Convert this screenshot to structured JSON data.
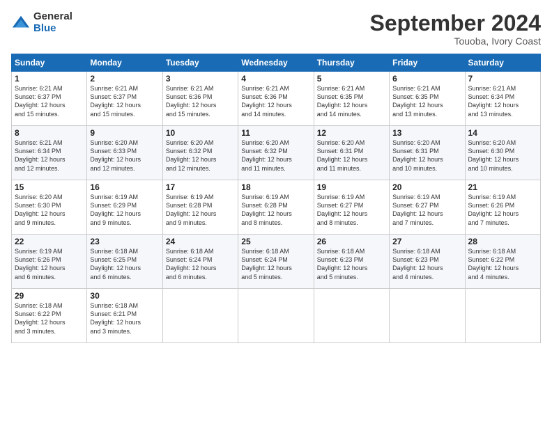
{
  "header": {
    "logo_general": "General",
    "logo_blue": "Blue",
    "month_title": "September 2024",
    "location": "Touoba, Ivory Coast"
  },
  "calendar": {
    "headers": [
      "Sunday",
      "Monday",
      "Tuesday",
      "Wednesday",
      "Thursday",
      "Friday",
      "Saturday"
    ],
    "weeks": [
      [
        {
          "day": "",
          "info": ""
        },
        {
          "day": "2",
          "info": "Sunrise: 6:21 AM\nSunset: 6:37 PM\nDaylight: 12 hours\nand 15 minutes."
        },
        {
          "day": "3",
          "info": "Sunrise: 6:21 AM\nSunset: 6:36 PM\nDaylight: 12 hours\nand 15 minutes."
        },
        {
          "day": "4",
          "info": "Sunrise: 6:21 AM\nSunset: 6:36 PM\nDaylight: 12 hours\nand 14 minutes."
        },
        {
          "day": "5",
          "info": "Sunrise: 6:21 AM\nSunset: 6:35 PM\nDaylight: 12 hours\nand 14 minutes."
        },
        {
          "day": "6",
          "info": "Sunrise: 6:21 AM\nSunset: 6:35 PM\nDaylight: 12 hours\nand 13 minutes."
        },
        {
          "day": "7",
          "info": "Sunrise: 6:21 AM\nSunset: 6:34 PM\nDaylight: 12 hours\nand 13 minutes."
        }
      ],
      [
        {
          "day": "1",
          "info": "Sunrise: 6:21 AM\nSunset: 6:37 PM\nDaylight: 12 hours\nand 15 minutes."
        },
        {
          "day": "9",
          "info": "Sunrise: 6:20 AM\nSunset: 6:33 PM\nDaylight: 12 hours\nand 12 minutes."
        },
        {
          "day": "10",
          "info": "Sunrise: 6:20 AM\nSunset: 6:32 PM\nDaylight: 12 hours\nand 12 minutes."
        },
        {
          "day": "11",
          "info": "Sunrise: 6:20 AM\nSunset: 6:32 PM\nDaylight: 12 hours\nand 11 minutes."
        },
        {
          "day": "12",
          "info": "Sunrise: 6:20 AM\nSunset: 6:31 PM\nDaylight: 12 hours\nand 11 minutes."
        },
        {
          "day": "13",
          "info": "Sunrise: 6:20 AM\nSunset: 6:31 PM\nDaylight: 12 hours\nand 10 minutes."
        },
        {
          "day": "14",
          "info": "Sunrise: 6:20 AM\nSunset: 6:30 PM\nDaylight: 12 hours\nand 10 minutes."
        }
      ],
      [
        {
          "day": "8",
          "info": "Sunrise: 6:21 AM\nSunset: 6:34 PM\nDaylight: 12 hours\nand 12 minutes."
        },
        {
          "day": "16",
          "info": "Sunrise: 6:19 AM\nSunset: 6:29 PM\nDaylight: 12 hours\nand 9 minutes."
        },
        {
          "day": "17",
          "info": "Sunrise: 6:19 AM\nSunset: 6:28 PM\nDaylight: 12 hours\nand 9 minutes."
        },
        {
          "day": "18",
          "info": "Sunrise: 6:19 AM\nSunset: 6:28 PM\nDaylight: 12 hours\nand 8 minutes."
        },
        {
          "day": "19",
          "info": "Sunrise: 6:19 AM\nSunset: 6:27 PM\nDaylight: 12 hours\nand 8 minutes."
        },
        {
          "day": "20",
          "info": "Sunrise: 6:19 AM\nSunset: 6:27 PM\nDaylight: 12 hours\nand 7 minutes."
        },
        {
          "day": "21",
          "info": "Sunrise: 6:19 AM\nSunset: 6:26 PM\nDaylight: 12 hours\nand 7 minutes."
        }
      ],
      [
        {
          "day": "15",
          "info": "Sunrise: 6:20 AM\nSunset: 6:30 PM\nDaylight: 12 hours\nand 9 minutes."
        },
        {
          "day": "23",
          "info": "Sunrise: 6:18 AM\nSunset: 6:25 PM\nDaylight: 12 hours\nand 6 minutes."
        },
        {
          "day": "24",
          "info": "Sunrise: 6:18 AM\nSunset: 6:24 PM\nDaylight: 12 hours\nand 6 minutes."
        },
        {
          "day": "25",
          "info": "Sunrise: 6:18 AM\nSunset: 6:24 PM\nDaylight: 12 hours\nand 5 minutes."
        },
        {
          "day": "26",
          "info": "Sunrise: 6:18 AM\nSunset: 6:23 PM\nDaylight: 12 hours\nand 5 minutes."
        },
        {
          "day": "27",
          "info": "Sunrise: 6:18 AM\nSunset: 6:23 PM\nDaylight: 12 hours\nand 4 minutes."
        },
        {
          "day": "28",
          "info": "Sunrise: 6:18 AM\nSunset: 6:22 PM\nDaylight: 12 hours\nand 4 minutes."
        }
      ],
      [
        {
          "day": "22",
          "info": "Sunrise: 6:19 AM\nSunset: 6:26 PM\nDaylight: 12 hours\nand 6 minutes."
        },
        {
          "day": "30",
          "info": "Sunrise: 6:18 AM\nSunset: 6:21 PM\nDaylight: 12 hours\nand 3 minutes."
        },
        {
          "day": "",
          "info": ""
        },
        {
          "day": "",
          "info": ""
        },
        {
          "day": "",
          "info": ""
        },
        {
          "day": "",
          "info": ""
        },
        {
          "day": "",
          "info": ""
        }
      ],
      [
        {
          "day": "29",
          "info": "Sunrise: 6:18 AM\nSunset: 6:22 PM\nDaylight: 12 hours\nand 3 minutes."
        },
        {
          "day": "",
          "info": ""
        },
        {
          "day": "",
          "info": ""
        },
        {
          "day": "",
          "info": ""
        },
        {
          "day": "",
          "info": ""
        },
        {
          "day": "",
          "info": ""
        },
        {
          "day": "",
          "info": ""
        }
      ]
    ]
  }
}
